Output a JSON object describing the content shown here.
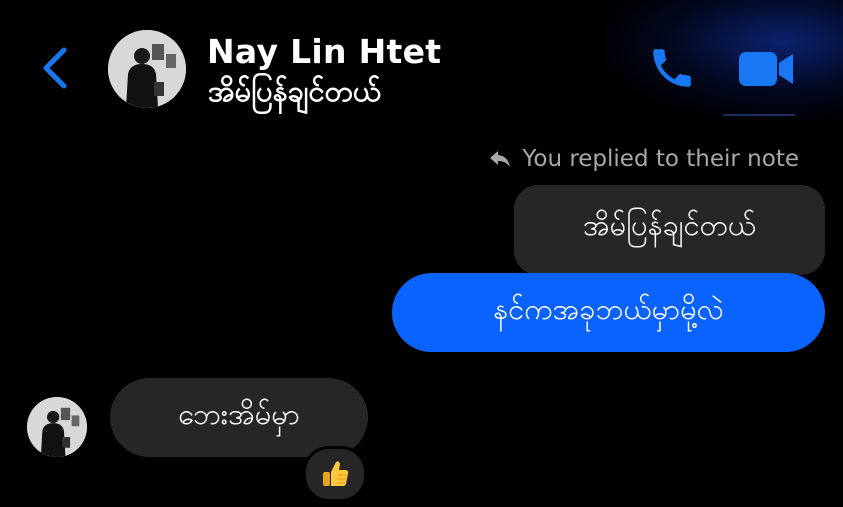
{
  "header": {
    "contact_name": "Nay Lin Htet",
    "contact_status": "အိမ်ပြန်ချင်တယ်",
    "accent_color": "#1877f2"
  },
  "conversation": {
    "reply_note_text": "You replied to their note",
    "quoted_note_text": "အိမ်ပြန်ချင်တယ်",
    "sent_message": "နင်ကအခုဘယ်မှာမို့လဲ",
    "received_message": "ဘေးအိမ်မှာ",
    "reaction_emoji": "👍"
  },
  "colors": {
    "background": "#000000",
    "sent_bubble": "#0a62ff",
    "received_bubble": "#262626",
    "muted_text": "#a8a8a8"
  },
  "icons": [
    "back-arrow-icon",
    "phone-icon",
    "video-camera-icon",
    "reply-arrow-icon",
    "thumbs-up-emoji"
  ]
}
